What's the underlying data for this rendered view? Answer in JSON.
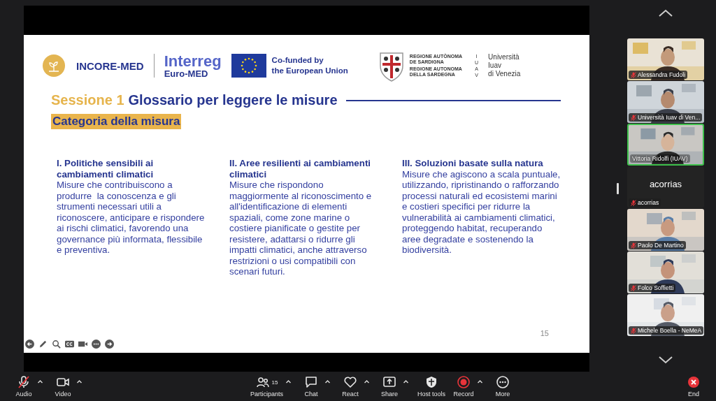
{
  "slide": {
    "logos": {
      "incore": "INCORE-MED",
      "interreg": "Interreg",
      "interreg_sub": "Euro-MED",
      "eu_line_1": "Co-funded by",
      "eu_line_2": "the European Union",
      "region_line_1": "REGIONE AUTÒNOMA",
      "region_line_2": "DE SARDIGNA",
      "region_line_3": "REGIONE AUTONOMA",
      "region_line_4": "DELLA SARDEGNA",
      "iuav_letters": [
        "I",
        "U",
        "A",
        "V"
      ],
      "university_lines": [
        "Università",
        "Iuav",
        "di Venezia"
      ]
    },
    "session_label": "Sessione 1",
    "title": "Glossario per leggere le misure",
    "subtitle": "Categoria della misura",
    "columns": [
      {
        "heading": "I. Politiche sensibili ai cambiamenti climatici",
        "lines": [
          "Misure che contribuiscono a",
          "produrre  la conoscenza e gli",
          "strumenti necessari utili a",
          "riconoscere, anticipare e rispondere",
          "ai rischi climatici, favorendo una",
          "governance più informata, flessibile",
          "e preventiva."
        ]
      },
      {
        "heading": "II. Aree resilienti ai cambiamenti climatici",
        "lines": [
          "Misure che rispondono",
          "maggiormente al riconoscimento e",
          "all'identificazione di elementi",
          "spaziali, come zone marine o",
          "costiere pianificate o gestite per",
          "resistere, adattarsi o ridurre gli",
          "impatti climatici, anche attraverso",
          "restrizioni o usi compatibili con",
          "scenari futuri."
        ]
      },
      {
        "heading": "III. Soluzioni basate sulla natura",
        "lines": [
          "Misure che agiscono a scala puntuale,",
          "utilizzando, ripristinando o rafforzando",
          "processi naturali ed ecosistemi marini",
          "e costieri specifici per ridurre la",
          "vulnerabilità ai cambiamenti climatici,",
          "proteggendo habitat, recuperando",
          "aree degradate e sostenendo la",
          "biodiversità."
        ]
      }
    ],
    "page_number": "15"
  },
  "participants": [
    {
      "name": "Alessandra Fudoli",
      "kind": "video",
      "muted": true,
      "active_speaker": false
    },
    {
      "name": "Università Iuav di Ven...",
      "kind": "video",
      "muted": true,
      "active_speaker": false
    },
    {
      "name": "Vittoria Ridolfi (IUAV)",
      "kind": "video",
      "muted": false,
      "active_speaker": true
    },
    {
      "name": "acorrias",
      "kind": "no_video",
      "display_name": "acorrias",
      "muted": true,
      "active_speaker": false
    },
    {
      "name": "Paolo De Martino",
      "kind": "video",
      "muted": true,
      "active_speaker": false
    },
    {
      "name": "Folco Soffietti",
      "kind": "video",
      "muted": true,
      "active_speaker": false
    },
    {
      "name": "Michele Boella - NeMeA",
      "kind": "video",
      "muted": true,
      "active_speaker": false
    }
  ],
  "toolbar": {
    "left": [
      {
        "label": "Audio",
        "kind": "mic",
        "muted": true,
        "caret": true
      },
      {
        "label": "Video",
        "kind": "camera",
        "caret": true
      }
    ],
    "center": [
      {
        "label": "Participants",
        "kind": "people",
        "count": "15",
        "caret": true
      },
      {
        "label": "Chat",
        "kind": "chat",
        "caret": true
      },
      {
        "label": "React",
        "kind": "heart",
        "caret": true
      },
      {
        "label": "Share",
        "kind": "share",
        "caret": true
      },
      {
        "label": "Host tools",
        "kind": "shield",
        "caret": false
      },
      {
        "label": "Record",
        "kind": "record",
        "caret": true
      },
      {
        "label": "More",
        "kind": "more",
        "caret": false
      }
    ],
    "end": {
      "label": "End"
    }
  }
}
